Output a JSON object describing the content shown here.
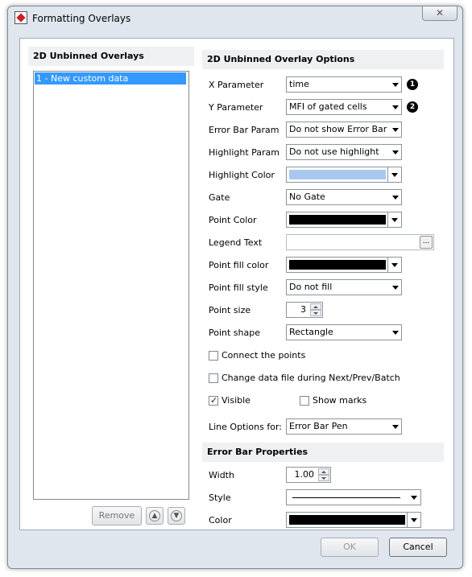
{
  "window": {
    "title": "Formatting Overlays",
    "close_label": "✕"
  },
  "left": {
    "header": "2D Unbinned Overlays",
    "items": [
      {
        "label": "1 - New custom data"
      }
    ],
    "remove_label": "Remove"
  },
  "options": {
    "header": "2D Unbinned Overlay Options",
    "x_param": {
      "label": "X Parameter",
      "value": "time",
      "badge": "1"
    },
    "y_param": {
      "label": "Y Parameter",
      "value": "MFI of gated cells",
      "badge": "2"
    },
    "error_bar_param": {
      "label": "Error Bar Param",
      "value": "Do not show Error Bar"
    },
    "highlight_param": {
      "label": "Highlight Param",
      "value": "Do not use highlight"
    },
    "highlight_color": {
      "label": "Highlight Color",
      "color": "#a9c8f0"
    },
    "gate": {
      "label": "Gate",
      "value": "No Gate"
    },
    "point_color": {
      "label": "Point Color",
      "color": "#000000"
    },
    "legend_text": {
      "label": "Legend Text",
      "value": "",
      "button": "..."
    },
    "point_fill_color": {
      "label": "Point fill color",
      "color": "#000000"
    },
    "point_fill_style": {
      "label": "Point fill style",
      "value": "Do not fill"
    },
    "point_size": {
      "label": "Point size",
      "value": "3"
    },
    "point_shape": {
      "label": "Point shape",
      "value": "Rectangle"
    },
    "connect_points": {
      "label": "Connect the points",
      "checked": false
    },
    "change_data_file": {
      "label": "Change data file during Next/Prev/Batch",
      "checked": false
    },
    "visible": {
      "label": "Visible",
      "checked": true
    },
    "show_marks": {
      "label": "Show marks",
      "checked": false
    },
    "line_options": {
      "label": "Line Options for:",
      "value": "Error Bar Pen"
    }
  },
  "error_bar": {
    "header": "Error Bar Properties",
    "width": {
      "label": "Width",
      "value": "1.00"
    },
    "style": {
      "label": "Style"
    },
    "color": {
      "label": "Color",
      "color": "#000000"
    }
  },
  "footer": {
    "ok_label": "OK",
    "cancel_label": "Cancel"
  }
}
